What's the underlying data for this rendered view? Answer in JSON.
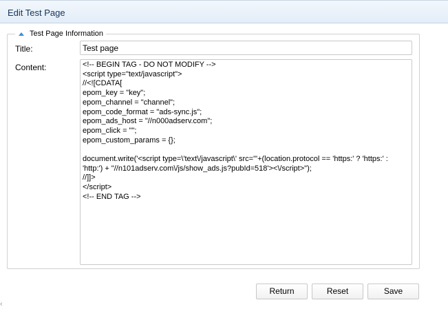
{
  "window": {
    "title": "Edit Test Page"
  },
  "section": {
    "legend": "Test Page Information",
    "icon": "collapse-up-icon"
  },
  "form": {
    "title_label": "Title:",
    "title_value": "Test page",
    "content_label": "Content:",
    "content_value": "<!-- BEGIN TAG - DO NOT MODIFY -->\n<script type=\"text/javascript\">\n//<![CDATA[\nepom_key = \"key\";\nepom_channel = \"channel\";\nepom_code_format = \"ads-sync.js\";\nepom_ads_host = \"//n000adserv.com\";\nepom_click = \"\";\nepom_custom_params = {};\n\ndocument.write('<script type=\\'text\\/javascript\\' src=\"'+(location.protocol == 'https:' ? 'https:' : 'http:') + \"//n101adserv.com\\/js/show_ads.js?pubId=518'><\\/script>\");\n//]]>\n</script>\n<!-- END TAG -->"
  },
  "buttons": {
    "return_label": "Return",
    "reset_label": "Reset",
    "save_label": "Save"
  },
  "side": {
    "arrow": "‹"
  }
}
